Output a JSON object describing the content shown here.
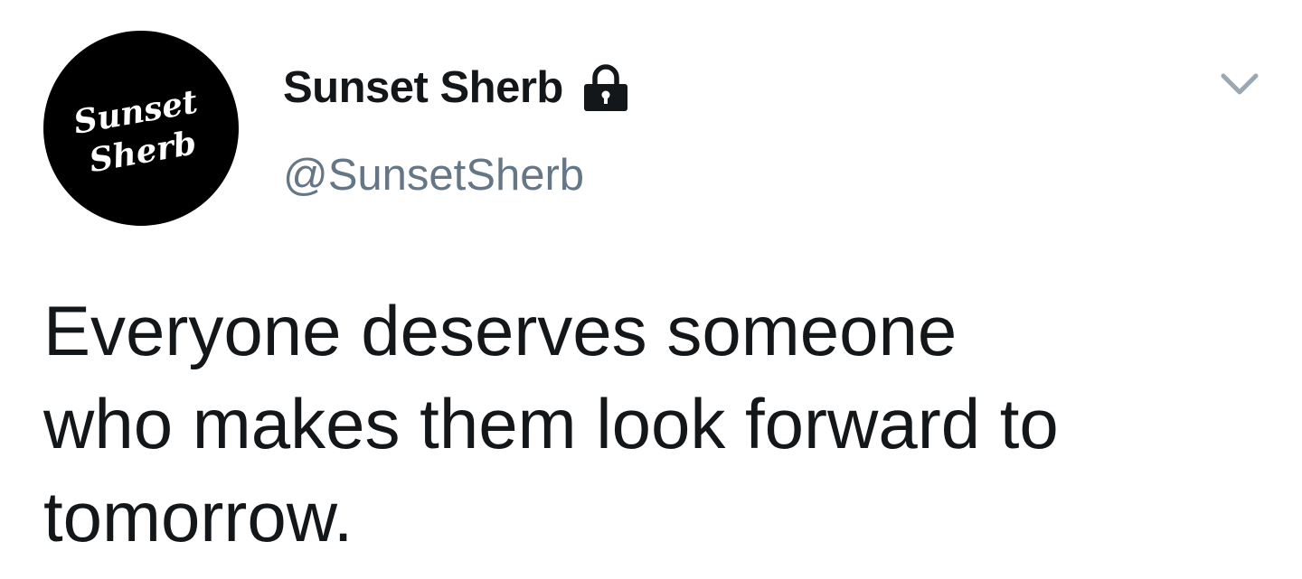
{
  "tweet": {
    "author": {
      "display_name": "Sunset Sherb",
      "handle": "@SunsetSherb",
      "protected": true,
      "avatar_text": [
        "Sunset",
        "Sherb"
      ]
    },
    "text": "Everyone deserves someone\nwho makes them look forward to\ntomorrow.",
    "icons": {
      "lock": "lock-icon",
      "caret": "chevron-down-icon"
    }
  },
  "colors": {
    "name": "#14171a",
    "handle": "#657786",
    "caret": "#9aa8b4",
    "avatar_bg": "#000000"
  }
}
